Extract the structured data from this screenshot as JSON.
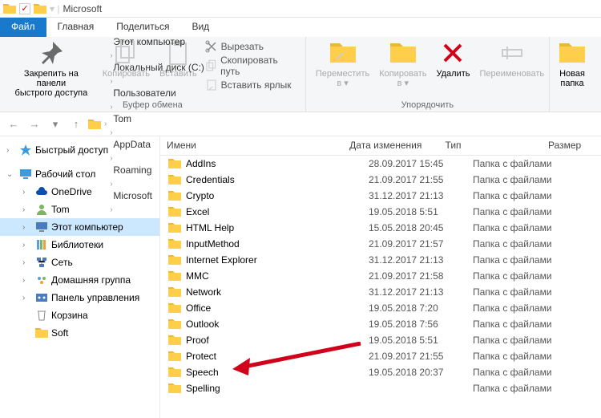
{
  "window": {
    "title": "Microsoft"
  },
  "tabs": {
    "file": "Файл",
    "home": "Главная",
    "share": "Поделиться",
    "view": "Вид"
  },
  "ribbon": {
    "pin": "Закрепить на панели\nбыстрого доступа",
    "copy": "Копировать",
    "paste": "Вставить",
    "cut": "Вырезать",
    "copy_path": "Скопировать путь",
    "paste_shortcut": "Вставить ярлык",
    "group_clipboard": "Буфер обмена",
    "move_to": "Переместить\nв ▾",
    "copy_to": "Копировать\nв ▾",
    "delete": "Удалить",
    "rename": "Переименовать",
    "group_organize": "Упорядочить",
    "new_folder": "Новая\nпапка"
  },
  "breadcrumbs": [
    "Этот компьютер",
    "Локальный диск (C:)",
    "Пользователи",
    "Tom",
    "AppData",
    "Roaming",
    "Microsoft"
  ],
  "columns": {
    "name": "Имени",
    "date": "Дата изменения",
    "type": "Тип",
    "size": "Размер"
  },
  "tree": {
    "quick": "Быстрый доступ",
    "desktop": "Рабочий стол",
    "onedrive": "OneDrive",
    "tom": "Tom",
    "thispc": "Этот компьютер",
    "libraries": "Библиотеки",
    "network": "Сеть",
    "homegroup": "Домашняя группа",
    "control": "Панель управления",
    "recycle": "Корзина",
    "soft": "Soft"
  },
  "rows": [
    {
      "name": "AddIns",
      "date": "28.09.2017 15:45",
      "type": "Папка с файлами"
    },
    {
      "name": "Credentials",
      "date": "21.09.2017 21:55",
      "type": "Папка с файлами"
    },
    {
      "name": "Crypto",
      "date": "31.12.2017 21:13",
      "type": "Папка с файлами"
    },
    {
      "name": "Excel",
      "date": "19.05.2018 5:51",
      "type": "Папка с файлами"
    },
    {
      "name": "HTML Help",
      "date": "15.05.2018 20:45",
      "type": "Папка с файлами"
    },
    {
      "name": "InputMethod",
      "date": "21.09.2017 21:57",
      "type": "Папка с файлами"
    },
    {
      "name": "Internet Explorer",
      "date": "31.12.2017 21:13",
      "type": "Папка с файлами"
    },
    {
      "name": "MMC",
      "date": "21.09.2017 21:58",
      "type": "Папка с файлами"
    },
    {
      "name": "Network",
      "date": "31.12.2017 21:13",
      "type": "Папка с файлами"
    },
    {
      "name": "Office",
      "date": "19.05.2018 7:20",
      "type": "Папка с файлами"
    },
    {
      "name": "Outlook",
      "date": "19.05.2018 7:56",
      "type": "Папка с файлами"
    },
    {
      "name": "Proof",
      "date": "19.05.2018 5:51",
      "type": "Папка с файлами"
    },
    {
      "name": "Protect",
      "date": "21.09.2017 21:55",
      "type": "Папка с файлами"
    },
    {
      "name": "Speech",
      "date": "19.05.2018 20:37",
      "type": "Папка с файлами"
    },
    {
      "name": "Spelling",
      "date": "",
      "type": "Папка с файлами"
    }
  ]
}
